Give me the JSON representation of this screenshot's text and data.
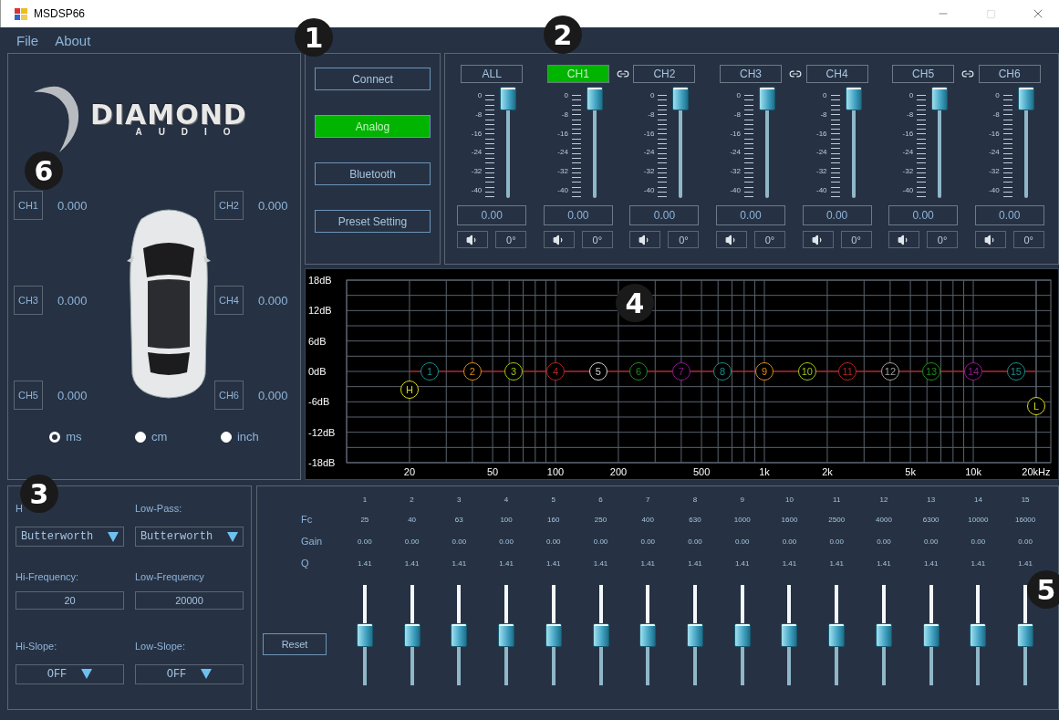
{
  "window": {
    "title": "MSDSP66"
  },
  "menu": [
    "File",
    "About"
  ],
  "logo": {
    "name": "DIAMOND",
    "sub": "AUDIO"
  },
  "speakers": [
    {
      "label": "CH1",
      "value": "0.000"
    },
    {
      "label": "CH2",
      "value": "0.000"
    },
    {
      "label": "CH3",
      "value": "0.000"
    },
    {
      "label": "CH4",
      "value": "0.000"
    },
    {
      "label": "CH5",
      "value": "0.000"
    },
    {
      "label": "CH6",
      "value": "0.000"
    }
  ],
  "units": [
    {
      "label": "ms",
      "selected": true
    },
    {
      "label": "cm",
      "selected": false
    },
    {
      "label": "inch",
      "selected": false
    }
  ],
  "sources": [
    {
      "label": "Connect",
      "selected": false
    },
    {
      "label": "Analog",
      "selected": true
    },
    {
      "label": "Bluetooth",
      "selected": false
    },
    {
      "label": "Preset Setting",
      "selected": false
    }
  ],
  "channels": [
    {
      "label": "ALL",
      "selected": false,
      "linked": false,
      "level": 1,
      "value": "0.00",
      "phase": "0°",
      "scale": [
        "0",
        "-8",
        "-16",
        "-24",
        "-32",
        "-40"
      ]
    },
    {
      "label": "CH1",
      "selected": true,
      "linked": true,
      "level": 1,
      "value": "0.00",
      "phase": "0°",
      "scale": [
        "0",
        "-8",
        "-16",
        "-24",
        "-32",
        "-40"
      ]
    },
    {
      "label": "CH2",
      "selected": false,
      "linked": false,
      "level": 1,
      "value": "0.00",
      "phase": "0°",
      "scale": [
        "0",
        "-8",
        "-16",
        "-24",
        "-32",
        "-40"
      ]
    },
    {
      "label": "CH3",
      "selected": false,
      "linked": true,
      "level": 1,
      "value": "0.00",
      "phase": "0°",
      "scale": [
        "0",
        "-8",
        "-16",
        "-24",
        "-32",
        "-40"
      ]
    },
    {
      "label": "CH4",
      "selected": false,
      "linked": false,
      "level": 1,
      "value": "0.00",
      "phase": "0°",
      "scale": [
        "0",
        "-8",
        "-16",
        "-24",
        "-32",
        "-40"
      ]
    },
    {
      "label": "CH5",
      "selected": false,
      "linked": true,
      "level": 1,
      "value": "0.00",
      "phase": "0°",
      "scale": [
        "0",
        "-8",
        "-16",
        "-24",
        "-32",
        "-40"
      ]
    },
    {
      "label": "CH6",
      "selected": false,
      "linked": false,
      "level": 1,
      "value": "0.00",
      "phase": "0°",
      "scale": [
        "0",
        "-8",
        "-16",
        "-24",
        "-32",
        "-40"
      ]
    }
  ],
  "graph": {
    "y_labels": [
      "18dB",
      "12dB",
      "6dB",
      "0dB",
      "-6dB",
      "-12dB",
      "-18dB"
    ],
    "x_labels": [
      "20",
      "50",
      "100",
      "200",
      "500",
      "1k",
      "2k",
      "5k",
      "10k",
      "20kHz"
    ],
    "markers": [
      {
        "label": "H",
        "color": "#d8d81c",
        "kind": "highpass"
      },
      {
        "label": "1",
        "color": "#1a8c8c",
        "kind": "band"
      },
      {
        "label": "2",
        "color": "#e08a10",
        "kind": "band"
      },
      {
        "label": "3",
        "color": "#9cc21c",
        "kind": "band"
      },
      {
        "label": "4",
        "color": "#b02424",
        "kind": "band"
      },
      {
        "label": "5",
        "color": "#d0d0d0",
        "kind": "band"
      },
      {
        "label": "6",
        "color": "#1c8c1c",
        "kind": "band"
      },
      {
        "label": "7",
        "color": "#8c1c8c",
        "kind": "band"
      },
      {
        "label": "8",
        "color": "#1a8c8c",
        "kind": "band"
      },
      {
        "label": "9",
        "color": "#e08a10",
        "kind": "band"
      },
      {
        "label": "10",
        "color": "#9cc21c",
        "kind": "band"
      },
      {
        "label": "11",
        "color": "#b02424",
        "kind": "band"
      },
      {
        "label": "12",
        "color": "#a0a0a0",
        "kind": "band"
      },
      {
        "label": "13",
        "color": "#1c8c1c",
        "kind": "band"
      },
      {
        "label": "14",
        "color": "#8c1c8c",
        "kind": "band"
      },
      {
        "label": "15",
        "color": "#1a8c8c",
        "kind": "band"
      },
      {
        "label": "L",
        "color": "#d8d81c",
        "kind": "lowpass"
      }
    ]
  },
  "filters": [
    {
      "label": "H",
      "kind": "select",
      "value": "Butterworth"
    },
    {
      "label": "Low-Pass:",
      "kind": "select",
      "value": "Butterworth"
    },
    {
      "label": "Hi-Frequency:",
      "kind": "field",
      "value": "20"
    },
    {
      "label": "Low-Frequency",
      "kind": "field",
      "value": "20000"
    },
    {
      "label": "Hi-Slope:",
      "kind": "select",
      "value": "OFF"
    },
    {
      "label": "Low-Slope:",
      "kind": "select",
      "value": "OFF"
    }
  ],
  "eq": {
    "row_labels": [
      "Fc",
      "Gain",
      "Q"
    ],
    "reset": "Reset",
    "bands": [
      {
        "number": "1",
        "fc": "25",
        "gain": "0.00",
        "q": "1.41",
        "level": 0.5
      },
      {
        "number": "2",
        "fc": "40",
        "gain": "0.00",
        "q": "1.41",
        "level": 0.5
      },
      {
        "number": "3",
        "fc": "63",
        "gain": "0.00",
        "q": "1.41",
        "level": 0.5
      },
      {
        "number": "4",
        "fc": "100",
        "gain": "0.00",
        "q": "1.41",
        "level": 0.5
      },
      {
        "number": "5",
        "fc": "160",
        "gain": "0.00",
        "q": "1.41",
        "level": 0.5
      },
      {
        "number": "6",
        "fc": "250",
        "gain": "0.00",
        "q": "1.41",
        "level": 0.5
      },
      {
        "number": "7",
        "fc": "400",
        "gain": "0.00",
        "q": "1.41",
        "level": 0.5
      },
      {
        "number": "8",
        "fc": "630",
        "gain": "0.00",
        "q": "1.41",
        "level": 0.5
      },
      {
        "number": "9",
        "fc": "1000",
        "gain": "0.00",
        "q": "1.41",
        "level": 0.5
      },
      {
        "number": "10",
        "fc": "1600",
        "gain": "0.00",
        "q": "1.41",
        "level": 0.5
      },
      {
        "number": "11",
        "fc": "2500",
        "gain": "0.00",
        "q": "1.41",
        "level": 0.5
      },
      {
        "number": "12",
        "fc": "4000",
        "gain": "0.00",
        "q": "1.41",
        "level": 0.5
      },
      {
        "number": "13",
        "fc": "6300",
        "gain": "0.00",
        "q": "1.41",
        "level": 0.5
      },
      {
        "number": "14",
        "fc": "10000",
        "gain": "0.00",
        "q": "1.41",
        "level": 0.5
      },
      {
        "number": "15",
        "fc": "16000",
        "gain": "0.00",
        "q": "1.41",
        "level": 0.5
      }
    ]
  },
  "callouts": [
    "1",
    "2",
    "3",
    "4",
    "5",
    "6"
  ]
}
